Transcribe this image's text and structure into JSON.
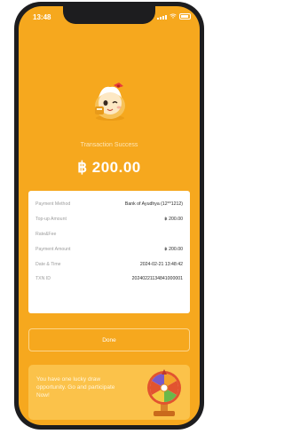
{
  "status_bar": {
    "time": "13:48"
  },
  "transaction": {
    "title": "Transaction Success",
    "amount": "฿ 200.00"
  },
  "details": [
    {
      "label": "Payment Method",
      "value": "Bank of Ayudhya (12**1212)"
    },
    {
      "label": "Top-up Amount",
      "value": "฿ 200.00"
    },
    {
      "label": "Rate&Fee",
      "value": ""
    },
    {
      "label": "Payment Amount",
      "value": "฿ 200.00"
    },
    {
      "label": "Date & Time",
      "value": "2024-02-21 13:48:42"
    },
    {
      "label": "TXN ID",
      "value": "20240221134841000001"
    }
  ],
  "done_button": {
    "label": "Done"
  },
  "promo": {
    "text": "You have one lucky draw opportunity. Go and participate Now!"
  },
  "colors": {
    "background": "#f6a81e",
    "card": "#ffffff",
    "promo": "#fbc24a"
  }
}
